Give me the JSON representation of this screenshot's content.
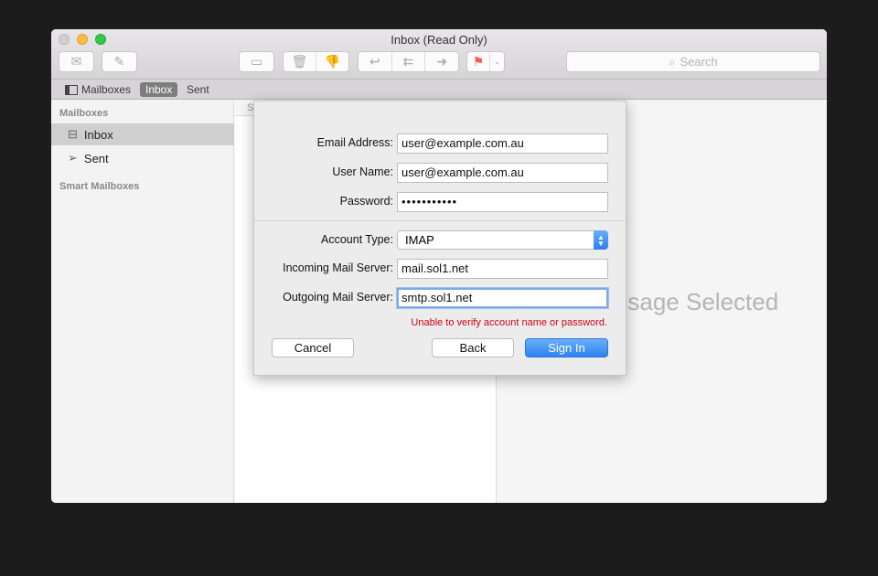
{
  "window": {
    "title": "Inbox (Read Only)"
  },
  "toolbar": {
    "search_placeholder": "Search",
    "icons": [
      "envelope-icon",
      "compose-icon",
      "archive-icon",
      "trash-icon",
      "junk-icon",
      "reply-icon",
      "reply-all-icon",
      "forward-icon",
      "flag-icon",
      "chevron-down-icon"
    ],
    "flag_color": "#fc5b5b"
  },
  "favorites": {
    "mailboxes": "Mailboxes",
    "inbox": "Inbox",
    "sent": "Sent"
  },
  "sidebar": {
    "header": "Mailboxes",
    "items": [
      {
        "label": "Inbox"
      },
      {
        "label": "Sent"
      }
    ],
    "smart_header": "Smart Mailboxes"
  },
  "list": {
    "sort_header": "S"
  },
  "viewer": {
    "empty": "No Message Selected"
  },
  "dialog": {
    "email_label": "Email Address:",
    "email_value": "user@example.com.au",
    "username_label": "User Name:",
    "username_value": "user@example.com.au",
    "password_label": "Password:",
    "password_value": "•••••••••••",
    "account_type_label": "Account Type:",
    "account_type_value": "IMAP",
    "incoming_label": "Incoming Mail Server:",
    "incoming_value": "mail.sol1.net",
    "outgoing_label": "Outgoing Mail Server:",
    "outgoing_value": "smtp.sol1.net",
    "error": "Unable to verify account name or password.",
    "cancel": "Cancel",
    "back": "Back",
    "sign_in": "Sign In"
  }
}
